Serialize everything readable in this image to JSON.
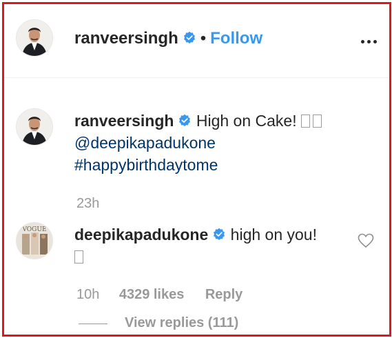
{
  "post": {
    "author": "ranveersingh",
    "separator": "•",
    "follow_label": "Follow"
  },
  "caption": {
    "username": "ranveersingh",
    "text": "High on Cake!",
    "mention": "@deepikapadukone",
    "hashtag": "#happybirthdaytome",
    "time": "23h"
  },
  "comment": {
    "username": "deepikapadukone",
    "text": "high on you!",
    "time": "10h",
    "likes": "4329 likes",
    "reply_label": "Reply",
    "view_replies": "View replies (111)"
  },
  "icons": {
    "verified": "verified-badge-icon",
    "more": "more-options-icon",
    "heart": "heart-outline-icon"
  },
  "colors": {
    "verified_blue": "#3897f0",
    "follow_blue": "#3897f0",
    "link_blue": "#003569",
    "muted_gray": "#999999",
    "frame_red": "#e0161d"
  }
}
